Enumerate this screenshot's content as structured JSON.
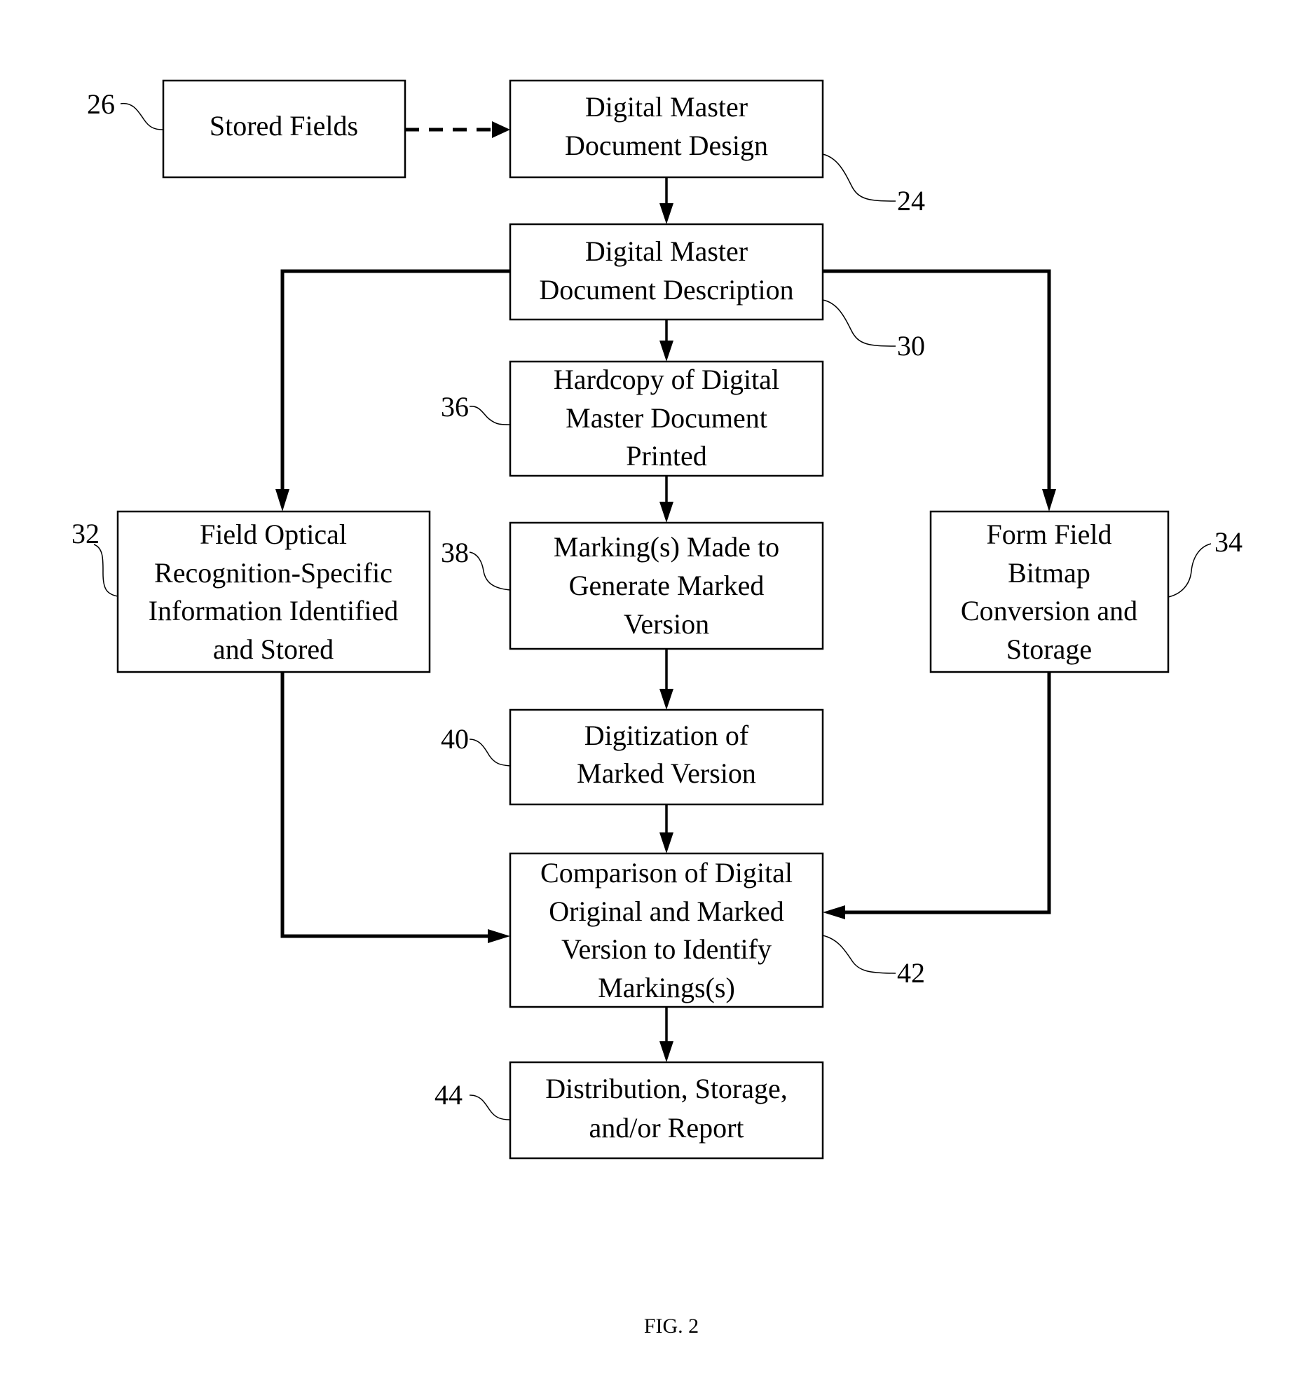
{
  "figure": {
    "caption": "FIG. 2",
    "nodes": [
      {
        "id": "stored-fields",
        "ref": "26",
        "lines": [
          "Stored Fields"
        ]
      },
      {
        "id": "master-design",
        "ref": "24",
        "lines": [
          "Digital Master",
          "Document Design"
        ]
      },
      {
        "id": "master-description",
        "ref": "30",
        "lines": [
          "Digital Master",
          "Document Description"
        ]
      },
      {
        "id": "hardcopy",
        "ref": "36",
        "lines": [
          "Hardcopy of Digital",
          "Master Document",
          "Printed"
        ]
      },
      {
        "id": "field-optical",
        "ref": "32",
        "lines": [
          "Field Optical",
          "Recognition-Specific",
          "Information Identified",
          "and Stored"
        ]
      },
      {
        "id": "markings-made",
        "ref": "38",
        "lines": [
          "Marking(s) Made to",
          "Generate Marked",
          "Version"
        ]
      },
      {
        "id": "form-field",
        "ref": "34",
        "lines": [
          "Form Field",
          "Bitmap",
          "Conversion and",
          "Storage"
        ]
      },
      {
        "id": "digitization",
        "ref": "40",
        "lines": [
          "Digitization of",
          "Marked Version"
        ]
      },
      {
        "id": "comparison",
        "ref": "42",
        "lines": [
          "Comparison of Digital",
          "Original and Marked",
          "Version to Identify",
          "Markings(s)"
        ]
      },
      {
        "id": "distribution",
        "ref": "44",
        "lines": [
          "Distribution, Storage,",
          "and/or Report"
        ]
      }
    ],
    "edges": [
      {
        "from": "stored-fields",
        "to": "master-design",
        "style": "dashed"
      },
      {
        "from": "master-design",
        "to": "master-description",
        "style": "solid"
      },
      {
        "from": "master-description",
        "to": "hardcopy",
        "style": "solid"
      },
      {
        "from": "master-description",
        "to": "field-optical",
        "style": "solid"
      },
      {
        "from": "master-description",
        "to": "form-field",
        "style": "solid"
      },
      {
        "from": "hardcopy",
        "to": "markings-made",
        "style": "solid"
      },
      {
        "from": "markings-made",
        "to": "digitization",
        "style": "solid"
      },
      {
        "from": "digitization",
        "to": "comparison",
        "style": "solid"
      },
      {
        "from": "field-optical",
        "to": "comparison",
        "style": "solid"
      },
      {
        "from": "form-field",
        "to": "comparison",
        "style": "solid"
      },
      {
        "from": "comparison",
        "to": "distribution",
        "style": "solid"
      }
    ]
  }
}
